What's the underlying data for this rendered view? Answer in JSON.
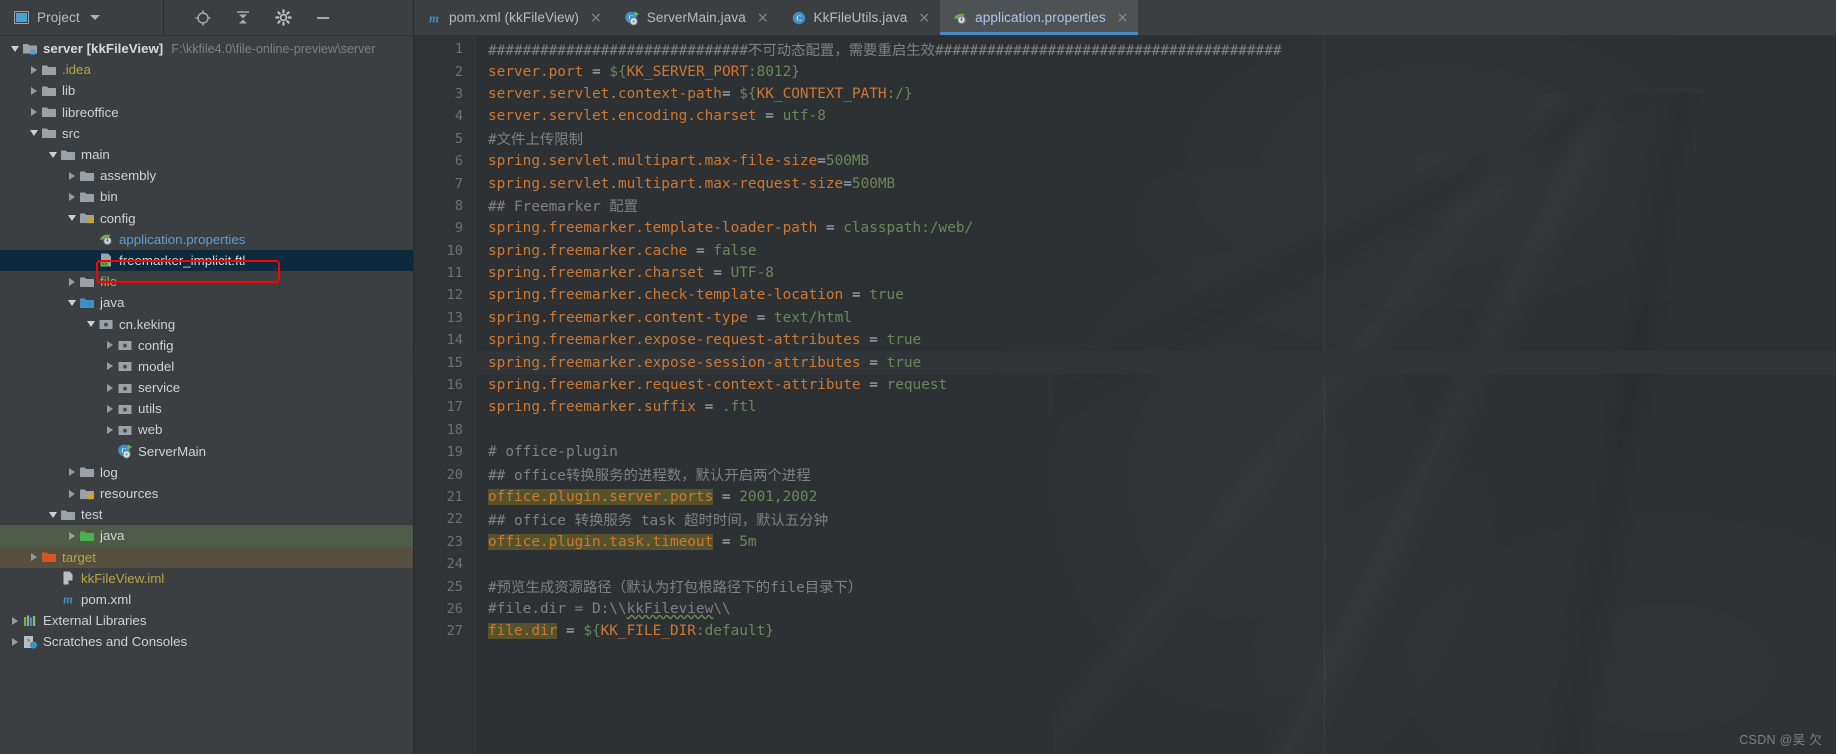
{
  "toolwindow": {
    "title": "Project",
    "dropdown_icon": "chevron-down-icon",
    "locate_icon": "locate-target-icon",
    "collapse_icon": "collapse-all-icon",
    "settings_icon": "gear-icon",
    "hide_icon": "minimize-icon"
  },
  "tabs": [
    {
      "label": "pom.xml (kkFileView)",
      "icon": "maven-m-icon",
      "close": "×",
      "active": false
    },
    {
      "label": "ServerMain.java",
      "icon": "java-run-class-icon",
      "close": "×",
      "active": false
    },
    {
      "label": "KkFileUtils.java",
      "icon": "java-class-icon",
      "close": "×",
      "active": false
    },
    {
      "label": "application.properties",
      "icon": "spring-properties-icon",
      "close": "×",
      "active": true
    }
  ],
  "tree": [
    {
      "depth": 0,
      "arrow": "open",
      "icon": "module-folder-icon",
      "label": "server [kkFileView]",
      "bold": true,
      "color": "white",
      "sublabel": "F:\\kkfile4.0\\file-online-preview\\server",
      "state": ""
    },
    {
      "depth": 1,
      "arrow": "closed",
      "icon": "folder-icon",
      "label": ".idea",
      "color": "yellow",
      "state": ""
    },
    {
      "depth": 1,
      "arrow": "closed",
      "icon": "folder-icon",
      "label": "lib",
      "color": "white",
      "state": ""
    },
    {
      "depth": 1,
      "arrow": "closed",
      "icon": "folder-icon",
      "label": "libreoffice",
      "color": "white",
      "state": ""
    },
    {
      "depth": 1,
      "arrow": "open",
      "icon": "folder-icon",
      "label": "src",
      "color": "white",
      "state": ""
    },
    {
      "depth": 2,
      "arrow": "open",
      "icon": "folder-icon",
      "label": "main",
      "color": "white",
      "state": ""
    },
    {
      "depth": 3,
      "arrow": "closed",
      "icon": "folder-icon",
      "label": "assembly",
      "color": "white",
      "state": ""
    },
    {
      "depth": 3,
      "arrow": "closed",
      "icon": "folder-icon",
      "label": "bin",
      "color": "white",
      "state": ""
    },
    {
      "depth": 3,
      "arrow": "open",
      "icon": "resource-folder-icon",
      "label": "config",
      "color": "white",
      "state": ""
    },
    {
      "depth": 4,
      "arrow": "none",
      "icon": "spring-properties-icon",
      "label": "application.properties",
      "color": "blue",
      "state": "annotated"
    },
    {
      "depth": 4,
      "arrow": "none",
      "icon": "ftl-file-icon",
      "label": "freemarker_implicit.ftl",
      "color": "white",
      "state": "selected"
    },
    {
      "depth": 3,
      "arrow": "closed",
      "icon": "folder-icon",
      "label": "file",
      "color": "yellow",
      "state": ""
    },
    {
      "depth": 3,
      "arrow": "open",
      "icon": "source-folder-icon",
      "label": "java",
      "color": "white",
      "state": ""
    },
    {
      "depth": 4,
      "arrow": "open",
      "icon": "package-icon",
      "label": "cn.keking",
      "color": "white",
      "state": ""
    },
    {
      "depth": 5,
      "arrow": "closed",
      "icon": "package-icon",
      "label": "config",
      "color": "white",
      "state": ""
    },
    {
      "depth": 5,
      "arrow": "closed",
      "icon": "package-icon",
      "label": "model",
      "color": "white",
      "state": ""
    },
    {
      "depth": 5,
      "arrow": "closed",
      "icon": "package-icon",
      "label": "service",
      "color": "white",
      "state": ""
    },
    {
      "depth": 5,
      "arrow": "closed",
      "icon": "package-icon",
      "label": "utils",
      "color": "white",
      "state": ""
    },
    {
      "depth": 5,
      "arrow": "closed",
      "icon": "package-icon",
      "label": "web",
      "color": "white",
      "state": ""
    },
    {
      "depth": 5,
      "arrow": "none",
      "icon": "java-run-class-icon",
      "label": "ServerMain",
      "color": "white",
      "state": ""
    },
    {
      "depth": 3,
      "arrow": "closed",
      "icon": "folder-icon",
      "label": "log",
      "color": "white",
      "state": ""
    },
    {
      "depth": 3,
      "arrow": "closed",
      "icon": "resource-folder-icon",
      "label": "resources",
      "color": "white",
      "state": ""
    },
    {
      "depth": 2,
      "arrow": "open",
      "icon": "folder-icon",
      "label": "test",
      "color": "white",
      "state": ""
    },
    {
      "depth": 3,
      "arrow": "closed",
      "icon": "test-source-folder-icon",
      "label": "java",
      "color": "white",
      "state": "test-root"
    },
    {
      "depth": 1,
      "arrow": "closed",
      "icon": "excluded-folder-icon",
      "label": "target",
      "color": "yellow",
      "state": "excluded"
    },
    {
      "depth": 2,
      "arrow": "none",
      "icon": "iml-file-icon",
      "label": "kkFileView.iml",
      "color": "yellow",
      "state": ""
    },
    {
      "depth": 2,
      "arrow": "none",
      "icon": "maven-m-icon",
      "label": "pom.xml",
      "color": "white",
      "state": ""
    },
    {
      "depth": 0,
      "arrow": "closed",
      "icon": "external-libraries-icon",
      "label": "External Libraries",
      "color": "white",
      "state": ""
    },
    {
      "depth": 0,
      "arrow": "closed",
      "icon": "scratches-icon",
      "label": "Scratches and Consoles",
      "color": "white",
      "state": ""
    }
  ],
  "editor": {
    "file": "application.properties",
    "caret_line": 15,
    "lines": [
      {
        "n": 1,
        "tokens": [
          {
            "t": "cm",
            "s": "##############################不可动态配置，需要重启生效########################################"
          }
        ]
      },
      {
        "n": 2,
        "tokens": [
          {
            "t": "k",
            "s": "server.port"
          },
          {
            "t": "eq",
            "s": " = "
          },
          {
            "t": "ph",
            "s": "${"
          },
          {
            "t": "phn",
            "s": "KK_SERVER_PORT"
          },
          {
            "t": "ph",
            "s": ":"
          },
          {
            "t": "phd",
            "s": "8012"
          },
          {
            "t": "ph",
            "s": "}"
          }
        ]
      },
      {
        "n": 3,
        "tokens": [
          {
            "t": "k",
            "s": "server.servlet.context-path"
          },
          {
            "t": "eq",
            "s": "= "
          },
          {
            "t": "ph",
            "s": "${"
          },
          {
            "t": "phn",
            "s": "KK_CONTEXT_PATH"
          },
          {
            "t": "ph",
            "s": ":"
          },
          {
            "t": "phd",
            "s": "/"
          },
          {
            "t": "ph",
            "s": "}"
          }
        ]
      },
      {
        "n": 4,
        "tokens": [
          {
            "t": "k",
            "s": "server.servlet.encoding.charset"
          },
          {
            "t": "eq",
            "s": " = "
          },
          {
            "t": "v",
            "s": "utf-8"
          }
        ]
      },
      {
        "n": 5,
        "tokens": [
          {
            "t": "cm",
            "s": "#文件上传限制"
          }
        ]
      },
      {
        "n": 6,
        "tokens": [
          {
            "t": "k",
            "s": "spring.servlet.multipart.max-file-size"
          },
          {
            "t": "eq",
            "s": "="
          },
          {
            "t": "v",
            "s": "500MB"
          }
        ]
      },
      {
        "n": 7,
        "tokens": [
          {
            "t": "k",
            "s": "spring.servlet.multipart.max-request-size"
          },
          {
            "t": "eq",
            "s": "="
          },
          {
            "t": "v",
            "s": "500MB"
          }
        ]
      },
      {
        "n": 8,
        "tokens": [
          {
            "t": "cm",
            "s": "## Freemarker 配置"
          }
        ]
      },
      {
        "n": 9,
        "tokens": [
          {
            "t": "k",
            "s": "spring.freemarker.template-loader-path"
          },
          {
            "t": "eq",
            "s": " = "
          },
          {
            "t": "v",
            "s": "classpath:/web/"
          }
        ]
      },
      {
        "n": 10,
        "tokens": [
          {
            "t": "k",
            "s": "spring.freemarker.cache"
          },
          {
            "t": "eq",
            "s": " = "
          },
          {
            "t": "v",
            "s": "false"
          }
        ]
      },
      {
        "n": 11,
        "tokens": [
          {
            "t": "k",
            "s": "spring.freemarker.charset"
          },
          {
            "t": "eq",
            "s": " = "
          },
          {
            "t": "v",
            "s": "UTF-8"
          }
        ]
      },
      {
        "n": 12,
        "tokens": [
          {
            "t": "k",
            "s": "spring.freemarker.check-template-location"
          },
          {
            "t": "eq",
            "s": " = "
          },
          {
            "t": "v",
            "s": "true"
          }
        ]
      },
      {
        "n": 13,
        "tokens": [
          {
            "t": "k",
            "s": "spring.freemarker.content-type"
          },
          {
            "t": "eq",
            "s": " = "
          },
          {
            "t": "v",
            "s": "text/html"
          }
        ]
      },
      {
        "n": 14,
        "tokens": [
          {
            "t": "k",
            "s": "spring.freemarker.expose-request-attributes"
          },
          {
            "t": "eq",
            "s": " = "
          },
          {
            "t": "v",
            "s": "true"
          }
        ]
      },
      {
        "n": 15,
        "tokens": [
          {
            "t": "k",
            "s": "spring.freemarker.expose-session-attributes"
          },
          {
            "t": "eq",
            "s": " = "
          },
          {
            "t": "v",
            "s": "true"
          }
        ]
      },
      {
        "n": 16,
        "tokens": [
          {
            "t": "k",
            "s": "spring.freemarker.request-context-attribute"
          },
          {
            "t": "eq",
            "s": " = "
          },
          {
            "t": "v",
            "s": "request"
          }
        ]
      },
      {
        "n": 17,
        "tokens": [
          {
            "t": "k",
            "s": "spring.freemarker.suffix"
          },
          {
            "t": "eq",
            "s": " = "
          },
          {
            "t": "v",
            "s": ".ftl"
          }
        ]
      },
      {
        "n": 18,
        "tokens": []
      },
      {
        "n": 19,
        "tokens": [
          {
            "t": "cm",
            "s": "# office-plugin"
          }
        ]
      },
      {
        "n": 20,
        "tokens": [
          {
            "t": "cm",
            "s": "## office转换服务的进程数，默认开启两个进程"
          }
        ]
      },
      {
        "n": 21,
        "tokens": [
          {
            "t": "k hl",
            "s": "office.plugin.server.ports"
          },
          {
            "t": "eq",
            "s": " = "
          },
          {
            "t": "v",
            "s": "2001,2002"
          }
        ]
      },
      {
        "n": 22,
        "tokens": [
          {
            "t": "cm",
            "s": "## office 转换服务 task 超时时间，默认五分钟"
          }
        ]
      },
      {
        "n": 23,
        "tokens": [
          {
            "t": "k hl",
            "s": "office.plugin.task.timeout"
          },
          {
            "t": "eq",
            "s": " = "
          },
          {
            "t": "v",
            "s": "5m"
          }
        ]
      },
      {
        "n": 24,
        "tokens": []
      },
      {
        "n": 25,
        "tokens": [
          {
            "t": "cm",
            "s": "#预览生成资源路径（默认为打包根路径下的file目录下）"
          }
        ]
      },
      {
        "n": 26,
        "tokens": [
          {
            "t": "cm",
            "s": "#file.dir = D:\\\\"
          },
          {
            "t": "cm squig",
            "s": "kkFileview"
          },
          {
            "t": "cm",
            "s": "\\\\"
          }
        ]
      },
      {
        "n": 27,
        "tokens": [
          {
            "t": "k hl",
            "s": "file.dir"
          },
          {
            "t": "eq",
            "s": " = "
          },
          {
            "t": "ph",
            "s": "${"
          },
          {
            "t": "phn",
            "s": "KK_FILE_DIR"
          },
          {
            "t": "ph",
            "s": ":"
          },
          {
            "t": "phd",
            "s": "default"
          },
          {
            "t": "ph",
            "s": "}"
          }
        ]
      }
    ]
  },
  "watermark": "CSDN @吴 欠",
  "colors": {
    "accent": "#4a88c7",
    "key": "#cc7832",
    "value": "#6a8759",
    "comment": "#808080",
    "highlight": "#56532c",
    "annotation": "#ff0000",
    "selection": "#0d293e",
    "test_root": "#4e5b49",
    "excluded": "#55503f"
  }
}
